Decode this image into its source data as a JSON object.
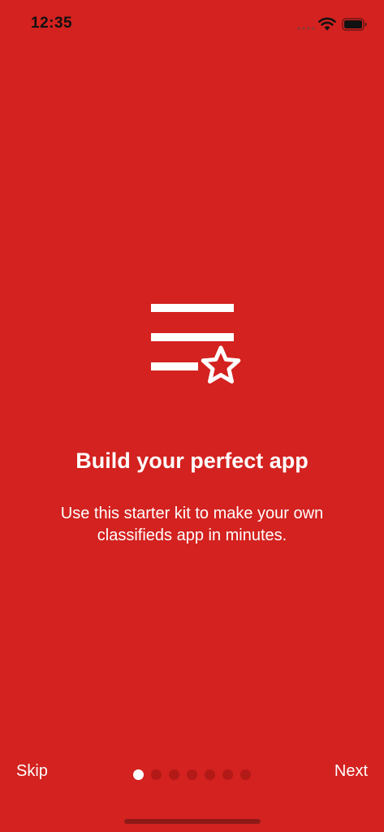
{
  "theme": {
    "background": "#D3221F",
    "foreground": "#FFFFFF",
    "status_text": "#111111",
    "dot_active": "#FFFFFF",
    "dot_inactive": "#B21917",
    "home_indicator": "#8E1A18"
  },
  "status_bar": {
    "time": "12:35",
    "icons": [
      "signal-dots-icon",
      "wifi-icon",
      "battery-icon"
    ]
  },
  "onboarding": {
    "icon": "list-star-icon",
    "title": "Build your perfect app",
    "subtitle": "Use this starter kit to make your own classifieds app in minutes."
  },
  "controls": {
    "skip_label": "Skip",
    "next_label": "Next",
    "pages": {
      "total": 7,
      "current": 1
    }
  }
}
